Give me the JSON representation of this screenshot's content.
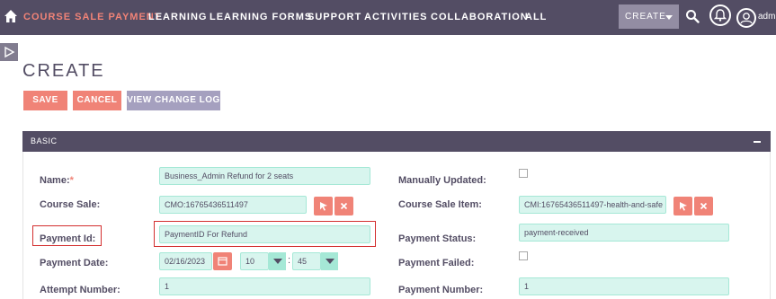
{
  "nav": {
    "items": [
      "COURSE SALE PAYMENT",
      "LEARNING",
      "LEARNING FORMS",
      "SUPPORT",
      "ACTIVITIES",
      "COLLABORATION",
      "ALL"
    ],
    "create_label": "CREATE",
    "user_label": "admi"
  },
  "page": {
    "title": "CREATE"
  },
  "actions": {
    "save": "SAVE",
    "cancel": "CANCEL",
    "view_change_log": "VIEW CHANGE LOG"
  },
  "panel": {
    "title": "BASIC"
  },
  "fields": {
    "name": {
      "label": "Name:",
      "required": "*",
      "value": "Business_Admin Refund for 2 seats"
    },
    "course_sale": {
      "label": "Course Sale:",
      "value": "CMO:16765436511497"
    },
    "payment_id": {
      "label": "Payment Id:",
      "value": "PaymentID For Refund"
    },
    "payment_date": {
      "label": "Payment Date:",
      "date": "02/16/2023",
      "hour": "10",
      "minute": "45",
      "separator": ":"
    },
    "attempt_number": {
      "label": "Attempt Number:",
      "value": "1"
    },
    "manually_updated": {
      "label": "Manually Updated:"
    },
    "course_sale_item": {
      "label": "Course Sale Item:",
      "value": "CMI:16765436511497-health-and-safe"
    },
    "payment_status": {
      "label": "Payment Status:",
      "value": "payment-received"
    },
    "payment_failed": {
      "label": "Payment Failed:"
    },
    "payment_number": {
      "label": "Payment Number:",
      "value": "1"
    }
  },
  "colors": {
    "nav_bg": "#534d64",
    "accent": "#f08377",
    "field_bg": "#d8f5ee",
    "highlight": "#d32f2f"
  },
  "icons": [
    "home-icon",
    "search-icon",
    "bell-icon",
    "user-avatar-icon",
    "sidebar-toggle-icon",
    "select-arrow-icon",
    "clear-icon",
    "calendar-icon",
    "collapse-icon"
  ]
}
